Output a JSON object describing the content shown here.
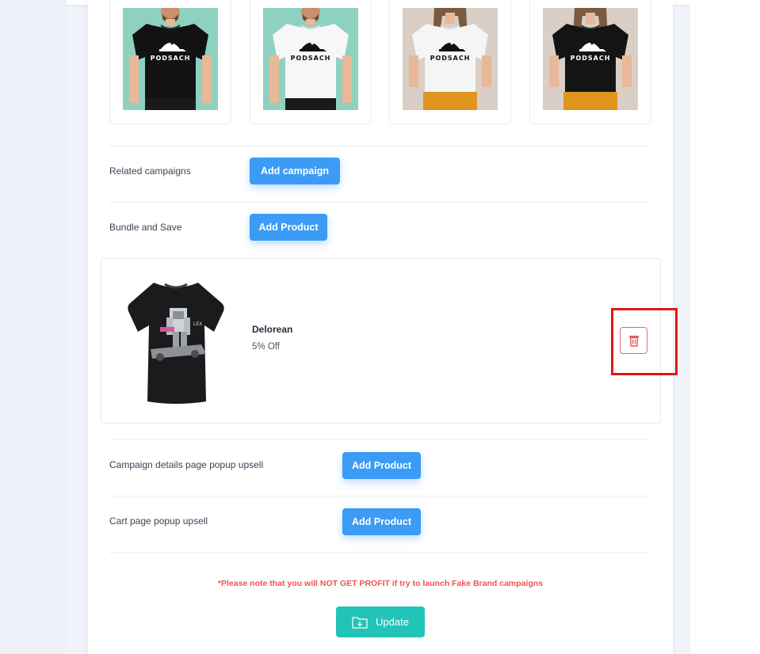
{
  "designs": [
    {
      "shirt_color": "#121212",
      "bg_color": "#8fd1c0",
      "logo": "PODSACH",
      "logo_color": "#ffffff",
      "model": "male"
    },
    {
      "shirt_color": "#f7f7f7",
      "bg_color": "#8fd1c0",
      "logo": "PODSACH",
      "logo_color": "#111111",
      "model": "male"
    },
    {
      "shirt_color": "#f5f5f5",
      "bg_color": "#d9cfc6",
      "logo": "PODSACH",
      "logo_color": "#111111",
      "model": "female"
    },
    {
      "shirt_color": "#141414",
      "bg_color": "#d9cfc6",
      "logo": "PODSACH",
      "logo_color": "#ffffff",
      "model": "female"
    }
  ],
  "sections": {
    "related_campaigns": {
      "label": "Related campaigns",
      "button": "Add campaign"
    },
    "bundle_and_save": {
      "label": "Bundle and Save",
      "button": "Add Product"
    },
    "campaign_popup": {
      "label": "Campaign details page popup upsell",
      "button": "Add Product"
    },
    "cart_popup": {
      "label": "Cart page popup upsell",
      "button": "Add Product"
    }
  },
  "bundle_product": {
    "name": "Delorean",
    "discount": "5% Off",
    "delete_icon": "trash-icon"
  },
  "notice": "*Please note that you will NOT GET PROFIT if try to launch Fake Brand campaigns",
  "update": {
    "label": "Update",
    "icon": "folder-download-icon"
  },
  "colors": {
    "primary": "#3b9bf5",
    "success": "#22c3b8",
    "danger": "#e01717",
    "notice": "#ef5350"
  }
}
